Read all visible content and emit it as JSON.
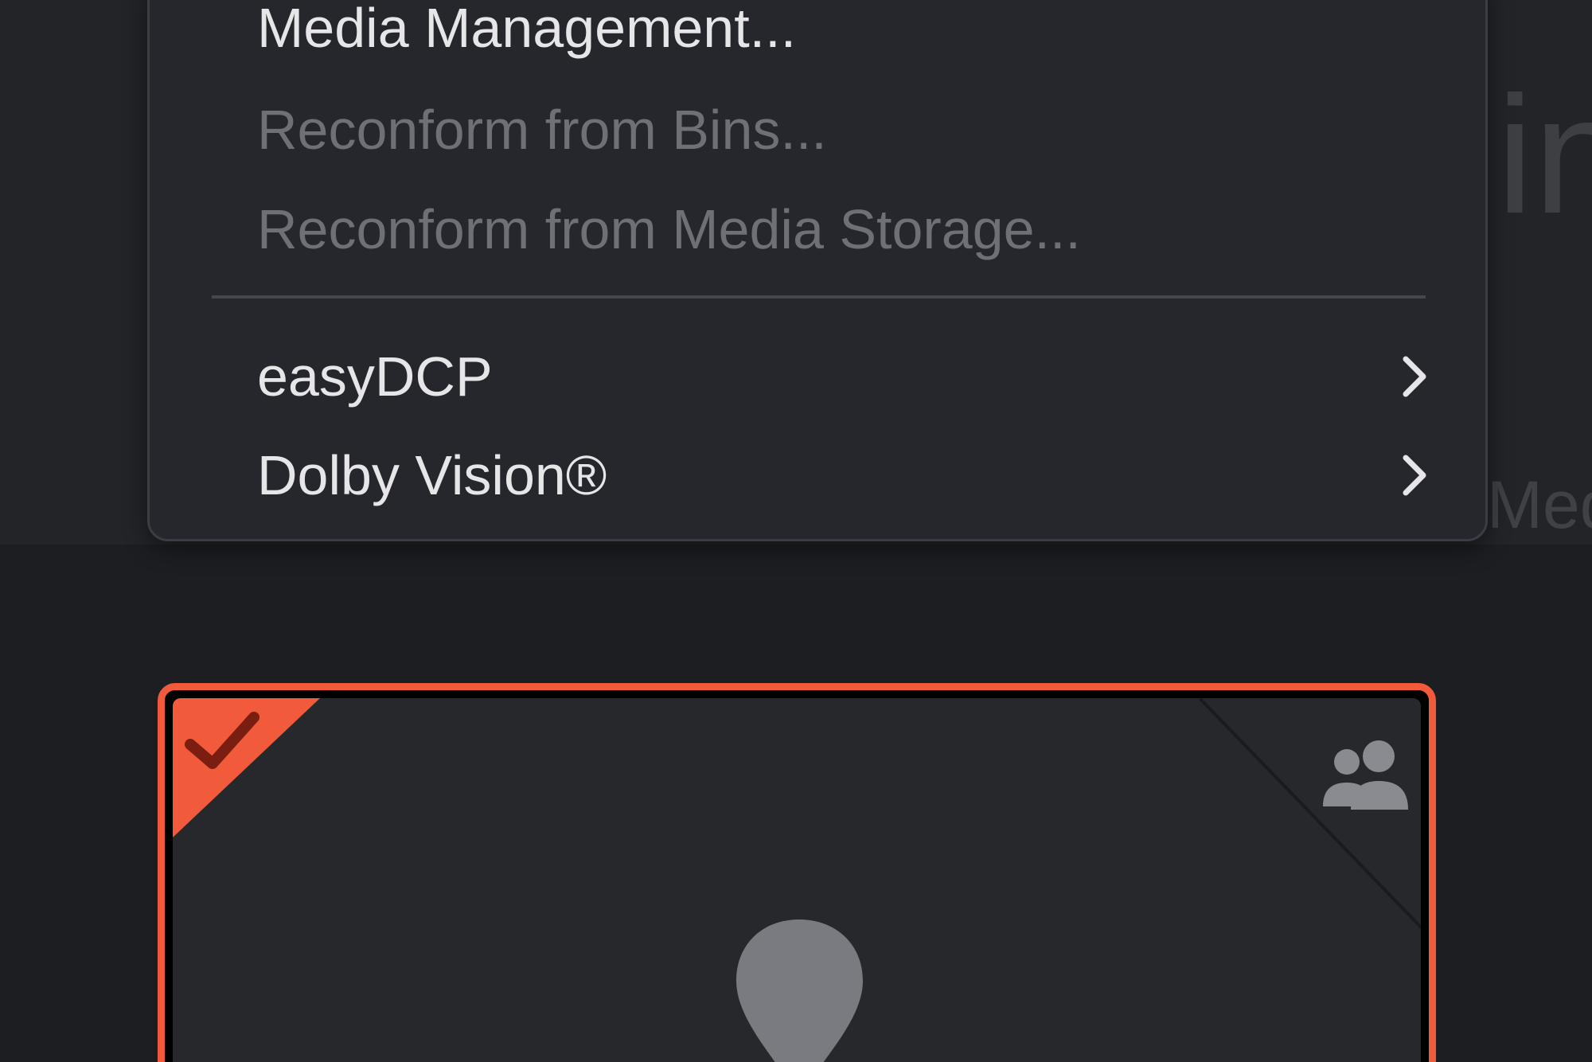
{
  "background": {
    "partial_title_text": "in",
    "partial_subtitle_text": "Med"
  },
  "menu": {
    "items": [
      {
        "label": "Media Management...",
        "enabled": true,
        "submenu": false
      },
      {
        "label": "Reconform from Bins...",
        "enabled": false,
        "submenu": false
      },
      {
        "label": "Reconform from Media Storage...",
        "enabled": false,
        "submenu": false
      },
      {
        "label": "easyDCP",
        "enabled": true,
        "submenu": true
      },
      {
        "label": "Dolby Vision®",
        "enabled": true,
        "submenu": true
      }
    ]
  },
  "card": {
    "selected": true,
    "accent_color": "#f15a3a",
    "icons": [
      "checkmark-icon",
      "people-icon",
      "location-pin-icon"
    ]
  },
  "colors": {
    "menu_background": "#25272d",
    "menu_text": "#e6e6e8",
    "menu_text_disabled": "#6e7077",
    "selection_border": "#f15a3a"
  }
}
